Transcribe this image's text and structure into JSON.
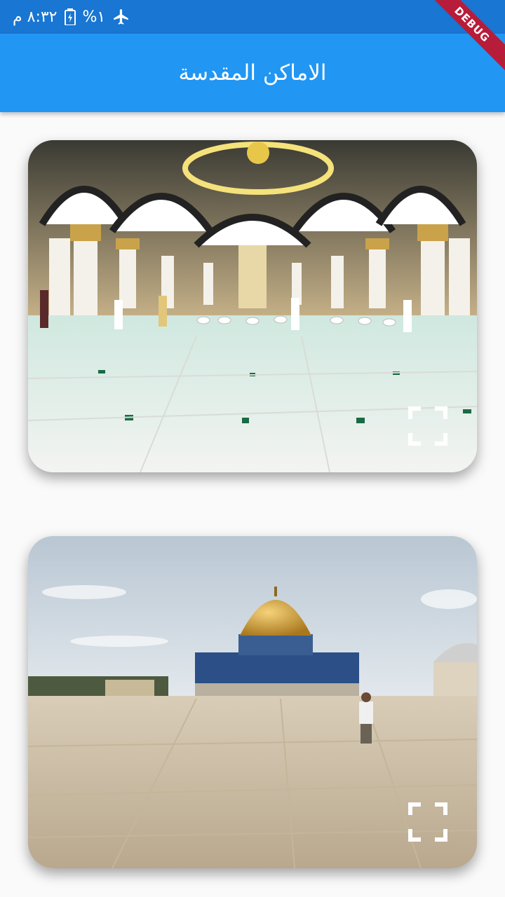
{
  "status_bar": {
    "time": "٨:٣٢ م",
    "battery_percent": "%١",
    "icons": [
      "battery-icon",
      "airplane-mode-icon"
    ]
  },
  "app_bar": {
    "title": "الاماكن المقدسة",
    "color": "#2196f3"
  },
  "debug_banner": {
    "label": "DEBUG"
  },
  "cards": [
    {
      "name": "mosque-interior-image",
      "icon": "fullscreen-icon"
    },
    {
      "name": "dome-of-the-rock-image",
      "icon": "fullscreen-icon"
    }
  ]
}
